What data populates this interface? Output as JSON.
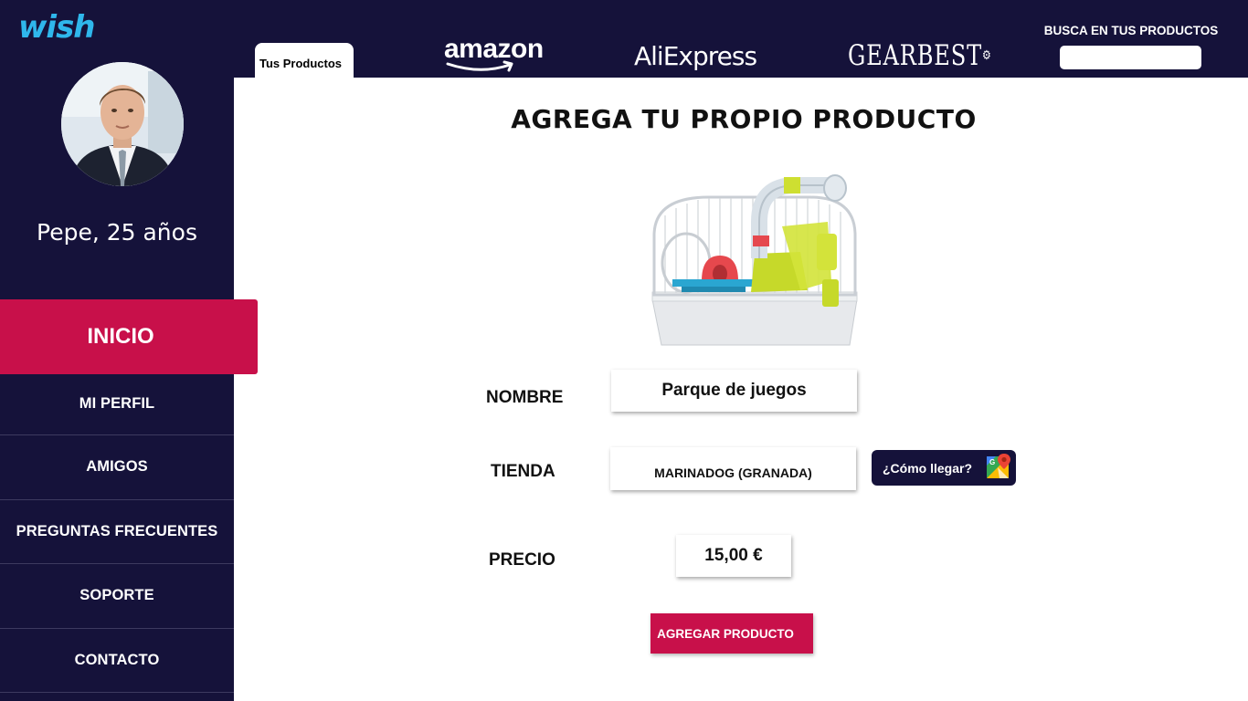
{
  "brand": {
    "name": "wish",
    "color": "#2fb7ec"
  },
  "colors": {
    "navy": "#15123a",
    "accent": "#c8104a",
    "white": "#ffffff"
  },
  "user": {
    "name": "Pepe, 25 años"
  },
  "sidebar": {
    "active": {
      "label": "INICIO"
    },
    "items": [
      {
        "label": "MI PERFIL"
      },
      {
        "label": "AMIGOS"
      },
      {
        "label": "PREGUNTAS FRECUENTES"
      },
      {
        "label": "SOPORTE"
      },
      {
        "label": "CONTACTO"
      }
    ]
  },
  "header": {
    "active_tab": "Tus Productos",
    "stores": [
      "amazon",
      "AliExpress",
      "GEARBEST"
    ],
    "search": {
      "label": "BUSCA EN TUS PRODUCTOS",
      "value": "",
      "placeholder": ""
    }
  },
  "main": {
    "title": "AGREGA TU PROPIO PRODUCTO",
    "product_image_icon": "hamster-cage-image",
    "fields": {
      "nombre": {
        "label": "NOMBRE",
        "value": "Parque de juegos"
      },
      "tienda": {
        "label": "TIENDA",
        "value": "MARINADOG (GRANADA)"
      },
      "precio": {
        "label": "PRECIO",
        "value": "15,00 €"
      }
    },
    "route_button": {
      "label": "¿Cómo llegar?",
      "icon": "google-maps-icon"
    },
    "submit_button": {
      "label": "AGREGAR PRODUCTO"
    }
  }
}
